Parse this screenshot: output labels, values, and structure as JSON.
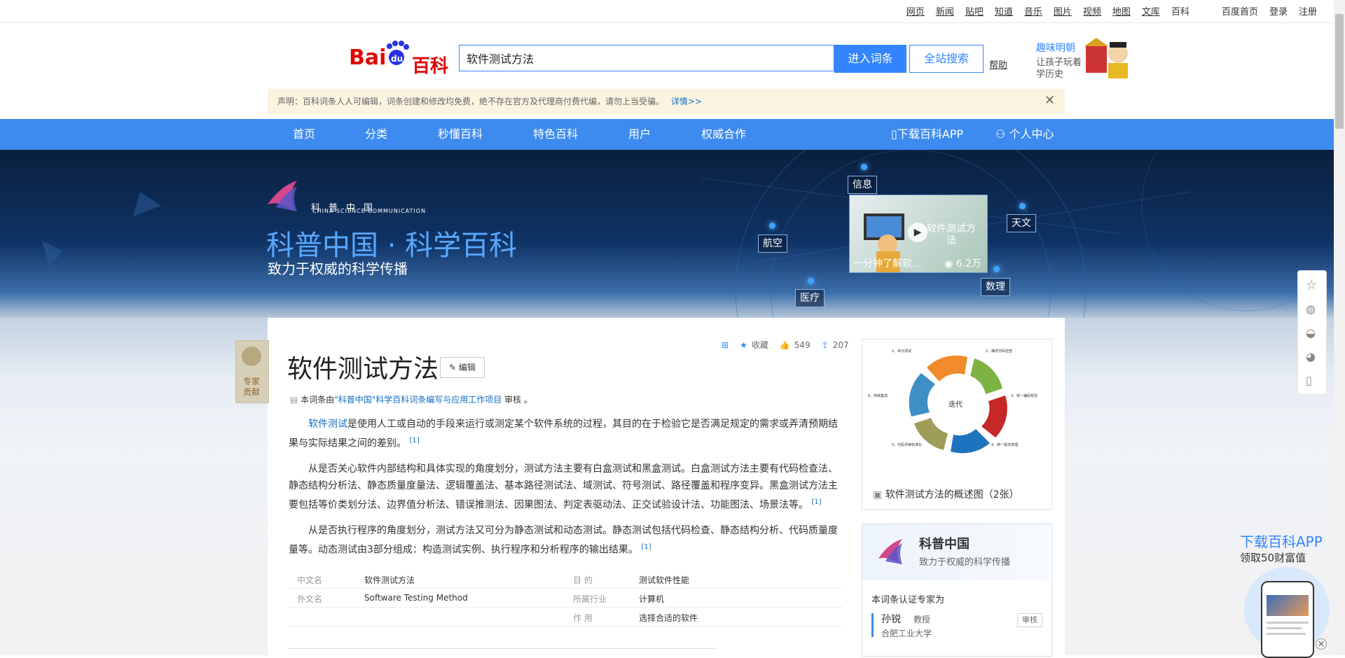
{
  "topnav": {
    "links": [
      "网页",
      "新闻",
      "贴吧",
      "知道",
      "音乐",
      "图片",
      "视频",
      "地图",
      "文库",
      "百科"
    ],
    "right_links": [
      "百度首页",
      "登录",
      "注册"
    ]
  },
  "header": {
    "logo_text": "百科",
    "search_value": "软件测试方法",
    "enter_button": "进入词条",
    "full_search_button": "全站搜索",
    "help": "帮助",
    "promo_title": "趣味明朝",
    "promo_line1": "让孩子玩着",
    "promo_line2": "学历史"
  },
  "notice": {
    "text": "声明：百科词条人人可编辑，词条创建和修改均免费，绝不存在官方及代理商付费代编，请勿上当受骗。",
    "link": "详情>>"
  },
  "mainnav": {
    "items": [
      "首页",
      "分类",
      "秒懂百科",
      "特色百科",
      "用户",
      "权威合作"
    ],
    "download": "下载百科APP",
    "personal": "个人中心"
  },
  "banner": {
    "logo_cn": "科普中国",
    "logo_en": "CHINA SCIENCE COMMUNICATION",
    "title": "科普中国 · 科学百科",
    "subtitle": "致力于权威的科学传播",
    "tags": [
      "信息",
      "航空",
      "天文",
      "医疗",
      "数理"
    ],
    "video_title": "一分钟了解软...",
    "video_views": "6.2万",
    "video_overlay": "软件测试方法"
  },
  "expert": {
    "label": "专家贡献"
  },
  "article": {
    "title": "软件测试方法",
    "edit_label": "编辑",
    "collect_label": "收藏",
    "like_count": "549",
    "share_count": "207",
    "review_prefix": "本词条由",
    "review_link": "\"科普中国\"科学百科词条编写与应用工作项目",
    "review_suffix": "审核 。",
    "p1_link": "软件测试",
    "p1_text": "是使用人工或自动的手段来运行或测定某个软件系统的过程，其目的在于检验它是否满足规定的需求或弄清预期结果与实际结果之间的差别。",
    "p2_text": "从是否关心软件内部结构和具体实现的角度划分，测试方法主要有白盒测试和黑盒测试。白盒测试方法主要有代码检查法、静态结构分析法、静态质量度量法、逻辑覆盖法、基本路径测试法、域测试、符号测试、路径覆盖和程序变异。黑盒测试方法主要包括等价类划分法、边界值分析法、错误推测法、因果图法、判定表驱动法、正交试验设计法、功能图法、场景法等。",
    "p3_text": "从是否执行程序的角度划分，测试方法又可分为静态测试和动态测试。静态测试包括代码检查、静态结构分析、代码质量度量等。动态测试由3部分组成：构造测试实例、执行程序和分析程序的输出结果。",
    "ref": "[1]"
  },
  "basic_info": {
    "rows": [
      {
        "name": "中文名",
        "value": "软件测试方法",
        "name2": "目    的",
        "value2": "测试软件性能"
      },
      {
        "name": "外文名",
        "value": "Software Testing Method",
        "name2": "所属行业",
        "value2": "计算机"
      },
      {
        "name": "",
        "value": "",
        "name2": "作    用",
        "value2": "选择合适的软件"
      }
    ]
  },
  "sidepic": {
    "center_label": "迭代",
    "caption": "软件测试方法的概述图（2张）",
    "labels": [
      "1、单元测试",
      "2、静态代码检查",
      "3、统一编码规范",
      "4、统一版本管理",
      "5、代码评审标准化",
      "6、持续集成"
    ]
  },
  "card": {
    "name": "科普中国",
    "sub": "致力于权威的科学传播",
    "expert_label": "本词条认证专家为",
    "expert_name": "孙锐",
    "expert_rank": "教授",
    "expert_school": "合肥工业大学",
    "expert_tag": "审核"
  },
  "download_app": {
    "title": "下载百科APP",
    "sub": "领取50财富值"
  },
  "colors": {
    "accent": "#3385ff",
    "nav": "#3d8bef",
    "notice_bg": "#fbf4e1"
  }
}
